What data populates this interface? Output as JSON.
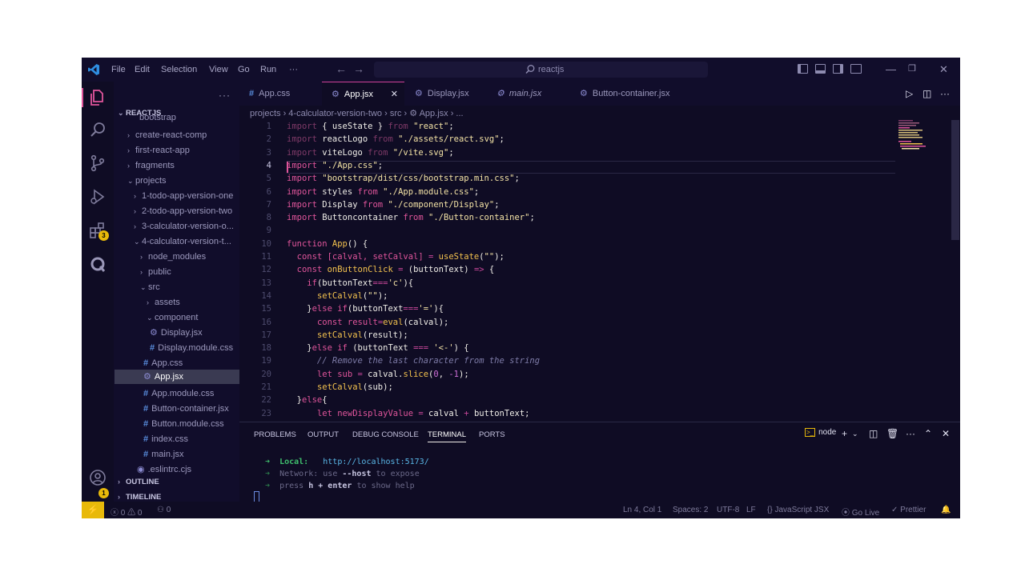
{
  "colors": {
    "accent": "#e0559b",
    "statusRemote": "#e8b90a",
    "background": "#0f0c24"
  },
  "titlebar": {
    "menu": [
      "File",
      "Edit",
      "Selection",
      "View",
      "Go",
      "Run",
      "···"
    ],
    "search": "reactjs"
  },
  "sidebar": {
    "more": "···",
    "root": "REACTJS",
    "items": [
      {
        "label": "bootstrap"
      },
      {
        "label": "create-react-comp"
      },
      {
        "label": "first-react-app"
      },
      {
        "label": "fragments"
      },
      {
        "label": "projects"
      },
      {
        "label": "1-todo-app-version-one"
      },
      {
        "label": "2-todo-app-version-two"
      },
      {
        "label": "3-calculator-version-o..."
      },
      {
        "label": "4-calculator-version-t..."
      },
      {
        "label": "node_modules"
      },
      {
        "label": "public"
      },
      {
        "label": "src"
      },
      {
        "label": "assets"
      },
      {
        "label": "component"
      },
      {
        "label": "Display.jsx"
      },
      {
        "label": "Display.module.css"
      },
      {
        "label": "App.css"
      },
      {
        "label": "App.jsx"
      },
      {
        "label": "App.module.css"
      },
      {
        "label": "Button-container.jsx"
      },
      {
        "label": "Button.module.css"
      },
      {
        "label": "index.css"
      },
      {
        "label": "main.jsx"
      },
      {
        "label": ".eslintrc.cjs"
      }
    ],
    "outline": "OUTLINE",
    "timeline": "TIMELINE",
    "extBadge": "3",
    "settingsBadge": "1"
  },
  "tabs": [
    "App.css",
    "App.jsx",
    "Display.jsx",
    "main.jsx",
    "Button-container.jsx"
  ],
  "breadcrumb": "projects › 4-calculator-version-two › src › ⚙ App.jsx › ...",
  "code": {
    "lineNumbers": [
      "1",
      "2",
      "3",
      "4",
      "5",
      "6",
      "7",
      "8",
      "9",
      "10",
      "11",
      "12",
      "13",
      "14",
      "15",
      "16",
      "17",
      "18",
      "19",
      "20",
      "21",
      "22",
      "23"
    ],
    "lines": [
      "import { useState } from \"react\";",
      "import reactLogo from \"./assets/react.svg\";",
      "import viteLogo from \"/vite.svg\";",
      "import \"./App.css\";",
      "import \"bootstrap/dist/css/bootstrap.min.css\";",
      "import styles from \"./App.module.css\";",
      "import Display from \"./component/Display\";",
      "import Buttoncontainer from \"./Button-container\";",
      "",
      "function App() {",
      "  const [calval, setCalval] = useState(\"\");",
      "  const onButtonClick = (buttonText) => {",
      "    if(buttonText==='c'){",
      "      setCalval(\"\");",
      "    }else if(buttonText==='='){",
      "      const result=eval(calval);",
      "      setCalval(result);",
      "    }else if (buttonText === '<-') {",
      "      // Remove the last character from the string",
      "      let sub = calval.slice(0, -1);",
      "      setCalval(sub);",
      "  }else{",
      "      let newDisplayValue = calval + buttonText;"
    ]
  },
  "panel": {
    "tabs": [
      "PROBLEMS",
      "OUTPUT",
      "DEBUG CONSOLE",
      "TERMINAL",
      "PORTS"
    ],
    "terminalName": "node",
    "terminal": {
      "localLabel": "Local:",
      "localUrl": "http://localhost:5173/",
      "networkLabel": "Network:",
      "networkText": "use",
      "hostFlag": "--host",
      "exposeText": "to expose",
      "helpPre": "press",
      "helpKey": "h + enter",
      "helpPost": "to show help"
    }
  },
  "status": {
    "errors": "0",
    "warnings": "0",
    "ports": "0",
    "position": "Ln 4, Col 1",
    "spaces": "Spaces: 2",
    "encoding": "UTF-8",
    "eol": "LF",
    "language": "JavaScript JSX",
    "golive": "Go Live",
    "prettier": "Prettier"
  }
}
